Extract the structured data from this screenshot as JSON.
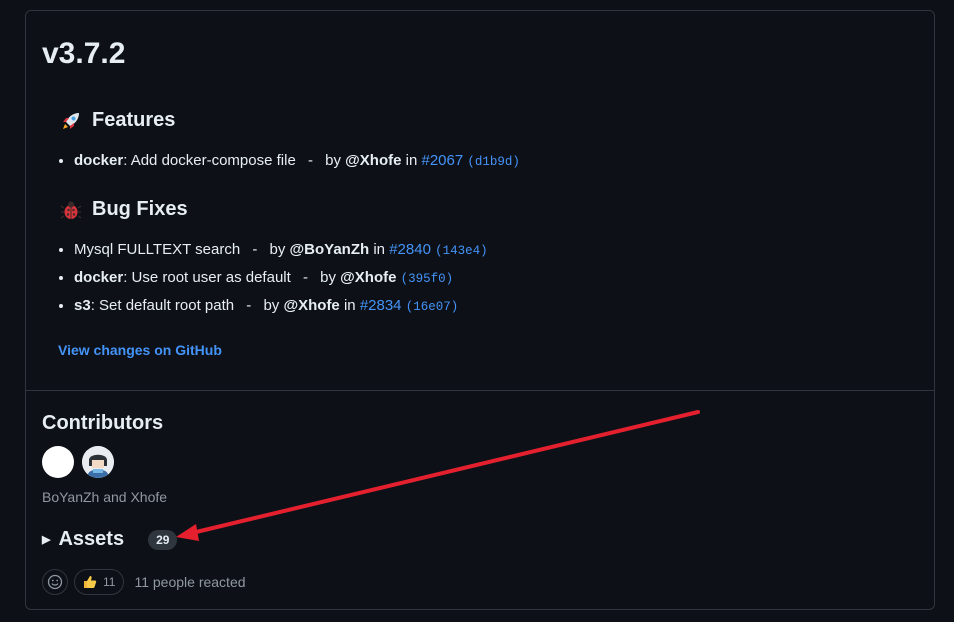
{
  "release": {
    "title": "v3.7.2",
    "features": {
      "heading": "Features",
      "items": [
        {
          "scope": "docker",
          "text": ": Add docker-compose file",
          "sep": "-",
          "by": "by",
          "author": "@Xhofe",
          "in": "in",
          "pr": "#2067",
          "commit": "(d1b9d)"
        }
      ]
    },
    "bugfixes": {
      "heading": "Bug Fixes",
      "items": [
        {
          "scope": "",
          "text": "Mysql FULLTEXT search",
          "sep": "-",
          "by": "by",
          "author": "@BoYanZh",
          "in": "in",
          "pr": "#2840",
          "commit": "(143e4)"
        },
        {
          "scope": "docker",
          "text": ": Use root user as default",
          "sep": "-",
          "by": "by",
          "author": "@Xhofe",
          "in": "",
          "pr": "",
          "commit": "(395f0)"
        },
        {
          "scope": "s3",
          "text": ": Set default root path",
          "sep": "-",
          "by": "by",
          "author": "@Xhofe",
          "in": "in",
          "pr": "#2834",
          "commit": "(16e07)"
        }
      ]
    },
    "view_changes": "View changes on GitHub"
  },
  "contributors": {
    "heading": "Contributors",
    "names": "BoYanZh and Xhofe"
  },
  "assets": {
    "label": "Assets",
    "count": "29"
  },
  "reactions": {
    "thumbs_count": "11",
    "summary": "11 people reacted"
  },
  "colors": {
    "background": "#0d1117",
    "border": "#30363d",
    "link": "#4493f8",
    "muted": "#9198a1",
    "annotation_arrow": "#e5202e"
  },
  "icons": [
    "rocket-icon",
    "bug-icon",
    "avatar-boyanzh",
    "avatar-xhofe",
    "triangle-right-icon",
    "smiley-icon",
    "thumbs-up-icon",
    "annotation-arrow"
  ]
}
